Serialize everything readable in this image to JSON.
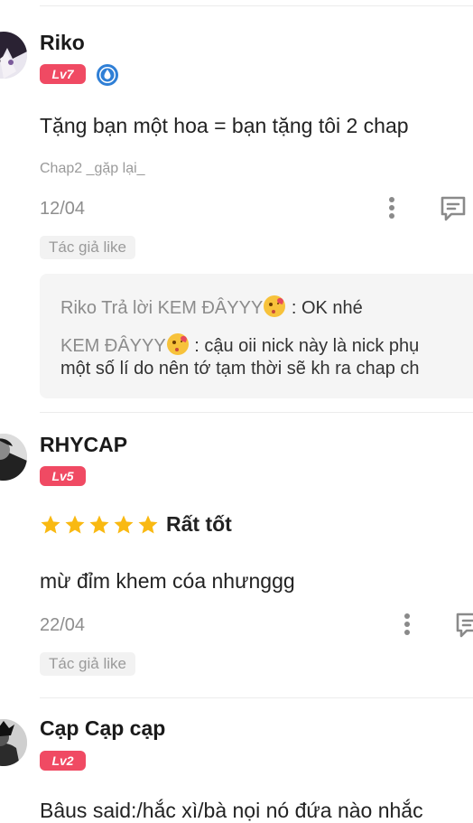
{
  "comments": [
    {
      "username": "Riko",
      "level": "Lv7",
      "badge_icon": "water-drop-badge-icon",
      "text": "Tặng bạn một hoa = bạn tặng tôi 2 chap",
      "chapter": "Chap2 _gặp lại_",
      "date": "12/04",
      "author_like": "Tác giả like",
      "replies": [
        {
          "from": "Riko Trả lời KEM ĐÂYYY",
          "sep": " : ",
          "text": "OK nhé"
        },
        {
          "from": "KEM ĐÂYYY",
          "sep": " : ",
          "text": "cậu oii nick này là nick phụ",
          "text2": "một số lí do nên tớ tạm thời sẽ kh ra chap ch"
        }
      ]
    },
    {
      "username": "RHYCAP",
      "level": "Lv5",
      "rating": 5,
      "rating_label": "Rất tốt",
      "text": "mừ đỉm khem cóa nhưnggg",
      "date": "22/04",
      "author_like": "Tác giả like"
    },
    {
      "username": "Cạp Cạp cạp",
      "level": "Lv2",
      "text": "Bâus said:/hắc xì/bà nọi nó đứa nào nhắc"
    }
  ],
  "colors": {
    "level_badge": "#f04a63",
    "star": "#f9b912",
    "reply_bg": "#f5f5f5"
  }
}
